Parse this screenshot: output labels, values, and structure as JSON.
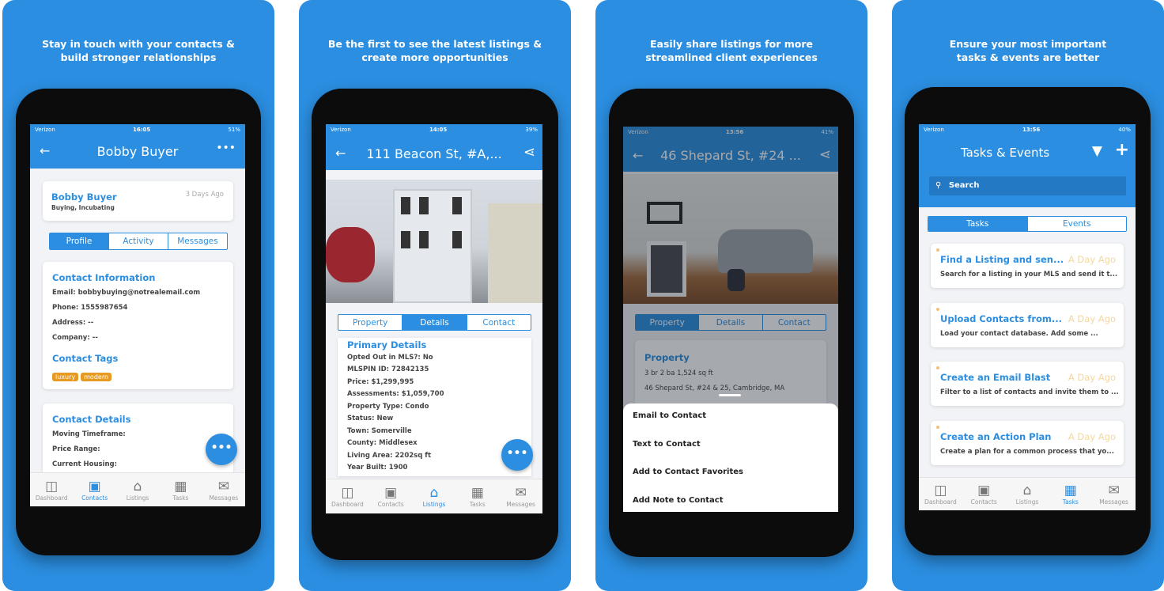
{
  "colors": {
    "brand_blue": "#2b8ee0",
    "tag_orange": "#e69a22"
  },
  "nav_labels": [
    "Dashboard",
    "Contacts",
    "Listings",
    "Tasks",
    "Messages"
  ],
  "panels": [
    {
      "caption": [
        "Stay in touch with your contacts &",
        "build stronger relationships"
      ],
      "status": {
        "carrier": "Verizon",
        "time": "16:05",
        "battery": "51%"
      },
      "title": "Bobby Buyer",
      "contact_card": {
        "name": "Bobby Buyer",
        "stage": "Buying, Incubating",
        "updated": "3 Days Ago"
      },
      "tabs": [
        "Profile",
        "Activity",
        "Messages"
      ],
      "active_tab": "Profile",
      "contact_info": {
        "heading": "Contact Information",
        "lines": [
          "Email: bobbybuying@notrealemail.com",
          "Phone: 1555987654",
          "Address: --",
          "Company: --"
        ]
      },
      "tags": {
        "heading": "Contact Tags",
        "items": [
          "luxury",
          "modern"
        ]
      },
      "details": {
        "heading": "Contact Details",
        "lines": [
          "Moving Timeframe:",
          "Price Range:",
          "Current Housing:"
        ]
      },
      "active_nav": "Contacts"
    },
    {
      "caption": [
        "Be the first to see the latest listings &",
        "create more opportunities"
      ],
      "status": {
        "carrier": "Verizon",
        "time": "14:05",
        "battery": "39%"
      },
      "title": "111 Beacon St, #A,...",
      "tabs": [
        "Property",
        "Details",
        "Contact"
      ],
      "active_tab": "Details",
      "primary": {
        "heading": "Primary Details",
        "lines": [
          "Opted Out in MLS?: No",
          "MLSPIN ID: 72842135",
          "Price: $1,299,995",
          "Assessments: $1,059,700",
          "Property Type: Condo",
          "Status: New",
          "Town: Somerville",
          "County: Middlesex",
          "Living Area: 2202sq ft",
          "Year Built: 1900"
        ]
      },
      "active_nav": "Listings"
    },
    {
      "caption": [
        "Easily share listings for more",
        "streamlined client experiences"
      ],
      "status": {
        "carrier": "Verizon",
        "time": "13:56",
        "battery": "41%"
      },
      "title": "46 Shepard St, #24 ...",
      "tabs": [
        "Property",
        "Details",
        "Contact"
      ],
      "active_tab": "Property",
      "property": {
        "heading": "Property",
        "lines": [
          "3 br 2 ba 1,524 sq ft",
          "46 Shepard St, #24 & 25, Cambridge, MA"
        ]
      },
      "share_menu": [
        "Email to Contact",
        "Text to Contact",
        "Add to Contact Favorites",
        "Add Note to Contact"
      ]
    },
    {
      "caption": [
        "Ensure your most important",
        "tasks & events are better"
      ],
      "status": {
        "carrier": "Verizon",
        "time": "13:56",
        "battery": "40%"
      },
      "title": "Tasks & Events",
      "search_placeholder": "Search",
      "tabs": [
        "Tasks",
        "Events"
      ],
      "active_tab": "Tasks",
      "tasks": [
        {
          "title": "Find a Listing and sen...",
          "when": "A Day Ago",
          "desc": "Search for a listing in your MLS and send it t..."
        },
        {
          "title": "Upload Contacts from...",
          "when": "A Day Ago",
          "desc": "Load your contact database. Add some ..."
        },
        {
          "title": "Create an Email Blast",
          "when": "A Day Ago",
          "desc": "Filter to a list of contacts and invite them to ..."
        },
        {
          "title": "Create an Action Plan",
          "when": "A Day Ago",
          "desc": "Create a plan for a common process that yo..."
        }
      ],
      "active_nav": "Tasks"
    }
  ]
}
